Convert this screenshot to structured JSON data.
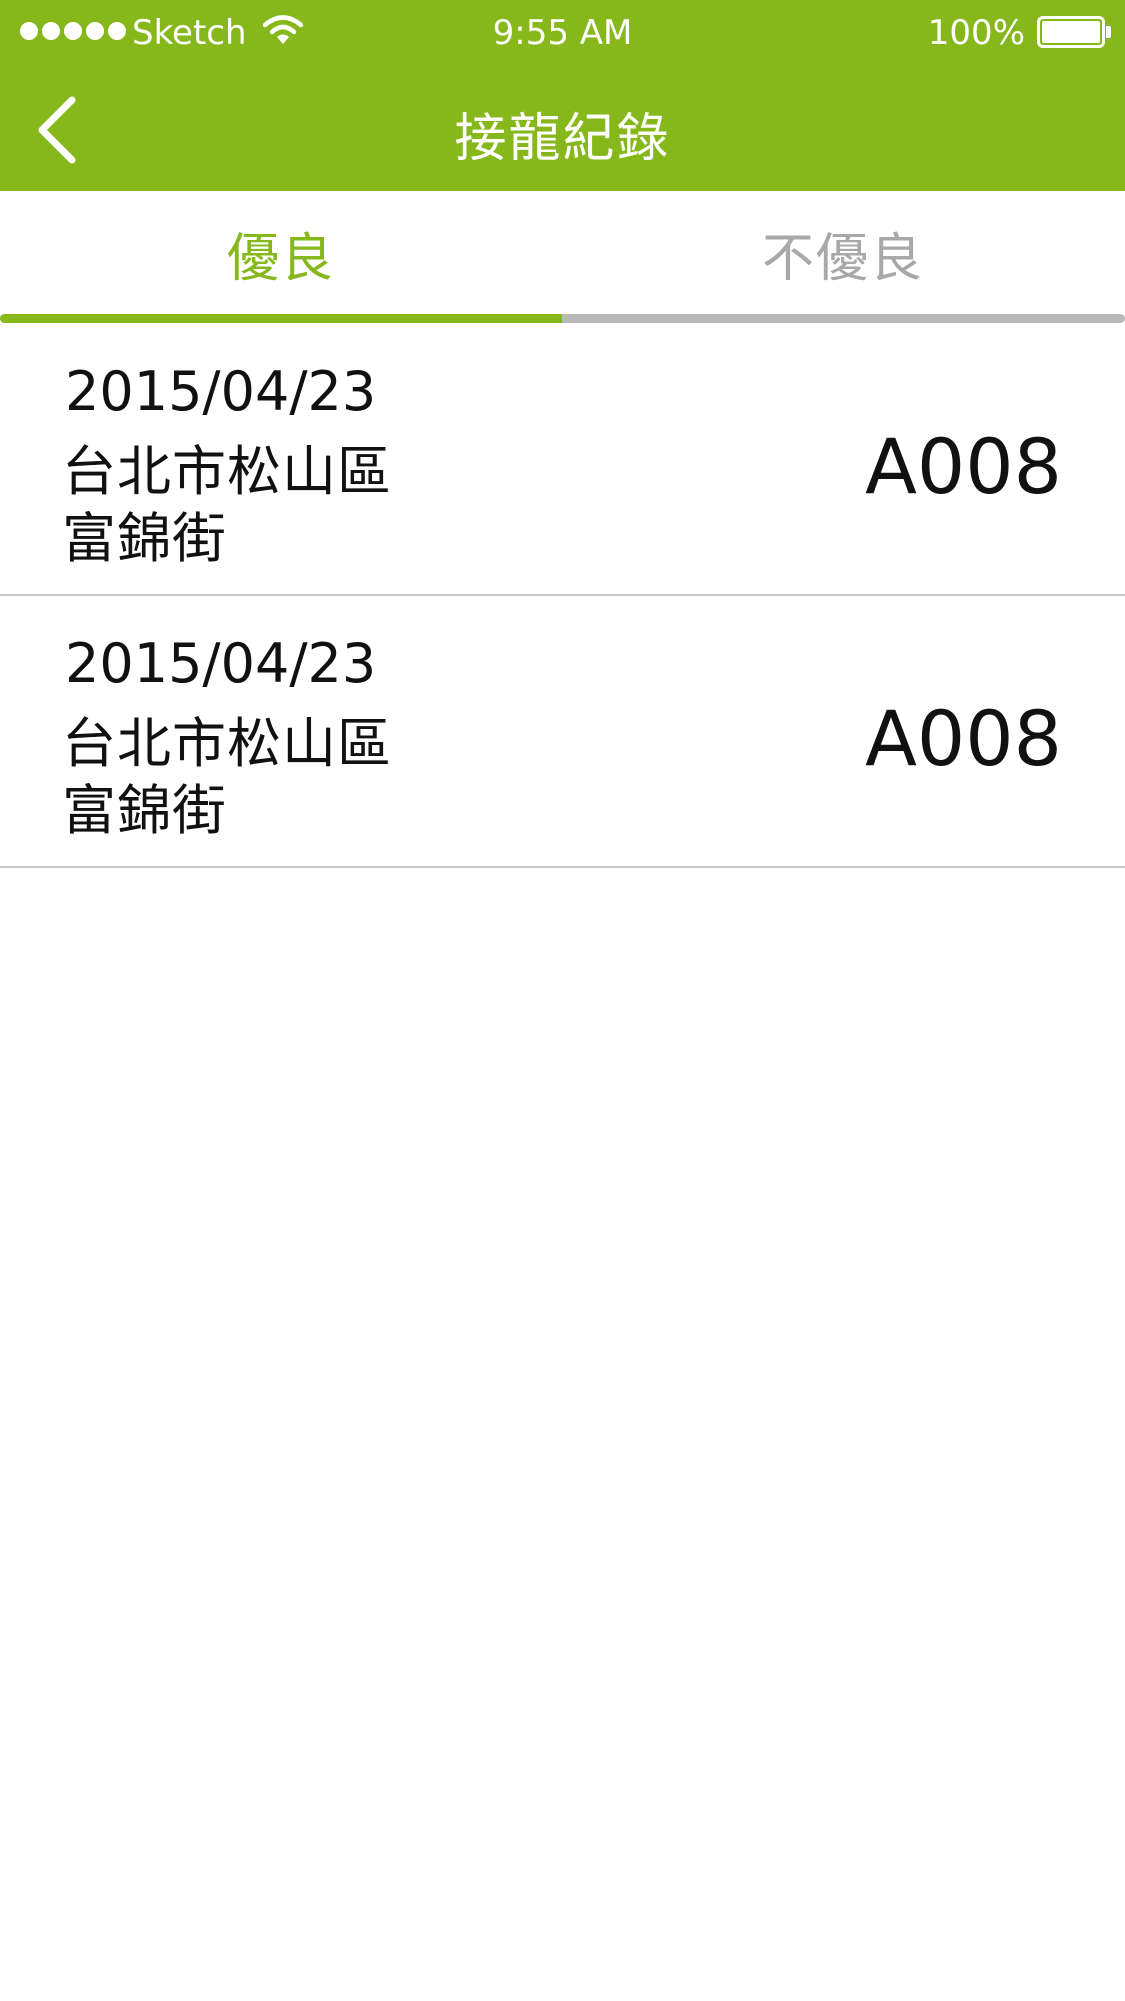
{
  "status_bar": {
    "carrier": "Sketch",
    "time": "9:55 AM",
    "battery": "100%",
    "icons": [
      "signal-dots-icon",
      "wifi-icon",
      "battery-icon"
    ]
  },
  "nav": {
    "title": "接龍紀錄",
    "back_icon": "chevron-left-icon"
  },
  "tabs": [
    {
      "label": "優良",
      "selected": true
    },
    {
      "label": "不優良",
      "selected": false
    }
  ],
  "records": [
    {
      "date": "2015/04/23",
      "district": "台北市松山區",
      "street": "富錦街",
      "code": "A008"
    },
    {
      "date": "2015/04/23",
      "district": "台北市松山區",
      "street": "富錦街",
      "code": "A008"
    }
  ],
  "colors": {
    "accent": "#86b81c",
    "tab_inactive": "#a8a8a8",
    "track": "#b8b8b8",
    "divider": "#c8c8c8",
    "text": "#111111"
  }
}
